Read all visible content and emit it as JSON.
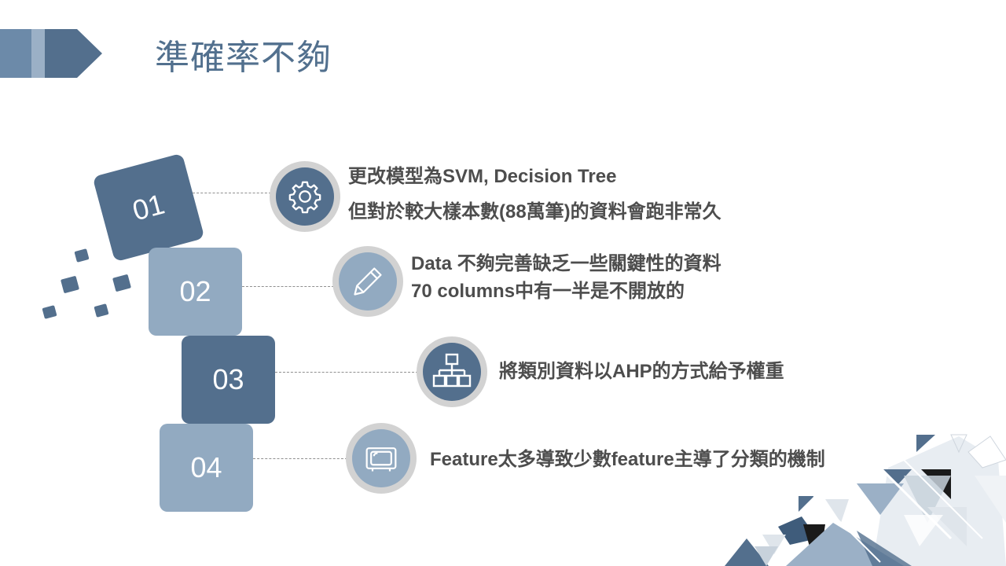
{
  "slide": {
    "title": "準確率不夠",
    "colors": {
      "accent_dark": "#536f8d",
      "accent_light": "#92aac1",
      "text": "#4d4d4d",
      "title": "#52708e"
    }
  },
  "items": [
    {
      "number": "01",
      "icon": "gear-icon",
      "lines": [
        "更改模型為SVM, Decision Tree",
        "但對於較大樣本數(88萬筆)的資料會跑非常久"
      ]
    },
    {
      "number": "02",
      "icon": "pencil-icon",
      "lines": [
        "Data 不夠完善缺乏一些關鍵性的資料",
        "70 columns中有一半是不開放的"
      ]
    },
    {
      "number": "03",
      "icon": "org-chart-icon",
      "lines": [
        "將類別資料以AHP的方式給予權重"
      ]
    },
    {
      "number": "04",
      "icon": "monitor-icon",
      "lines": [
        "Feature太多導致少數feature主導了分類的機制"
      ]
    }
  ]
}
